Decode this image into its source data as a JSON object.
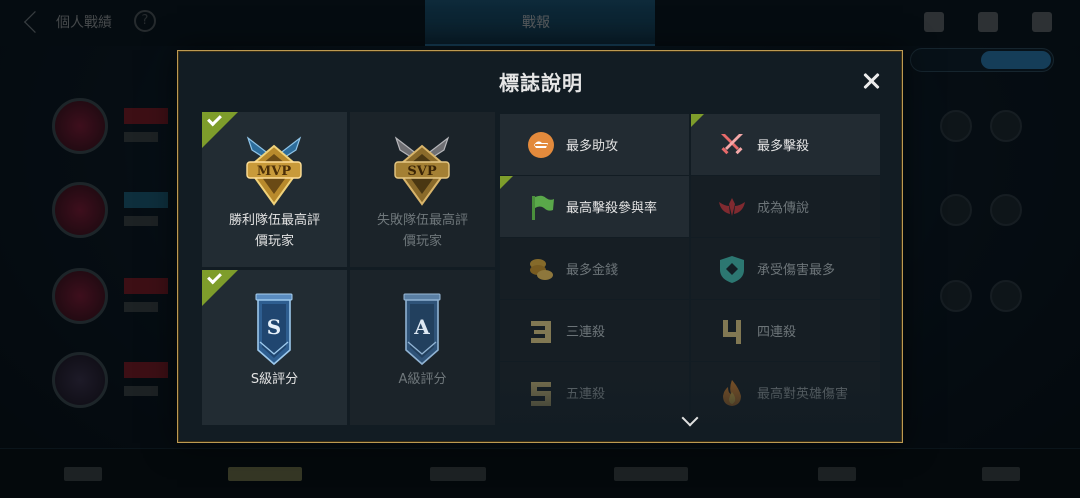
{
  "background": {
    "top_title": "個人戰績",
    "center_tab": "戰報",
    "help_symbol": "?"
  },
  "modal": {
    "title": "標誌說明",
    "close_label": "✕"
  },
  "rank_badges": [
    {
      "badge_text": "MVP",
      "label_line1": "勝利隊伍最高評",
      "label_line2": "價玩家",
      "achieved": true
    },
    {
      "badge_text": "SVP",
      "label_line1": "失敗隊伍最高評",
      "label_line2": "價玩家",
      "achieved": false
    },
    {
      "badge_text": "S",
      "label_line1": "S級評分",
      "label_line2": "",
      "achieved": true
    },
    {
      "badge_text": "A",
      "label_line1": "A級評分",
      "label_line2": "",
      "achieved": false
    }
  ],
  "features": [
    {
      "label": "最多助攻",
      "icon": "handshake-icon",
      "achieved": false,
      "color": "#e38a3c"
    },
    {
      "label": "最多擊殺",
      "icon": "crossed-swords-icon",
      "achieved": true,
      "color": "#e86a6a"
    },
    {
      "label": "最高擊殺參與率",
      "icon": "flag-icon",
      "achieved": true,
      "color": "#5aa84a"
    },
    {
      "label": "成為傳說",
      "icon": "legend-wings-icon",
      "achieved": false,
      "color": "#d8343a"
    },
    {
      "label": "最多金錢",
      "icon": "coins-icon",
      "achieved": false,
      "color": "#e0a830"
    },
    {
      "label": "承受傷害最多",
      "icon": "shield-icon",
      "achieved": false,
      "color": "#3fc0b0"
    },
    {
      "label": "三連殺",
      "icon": "triple-kill-icon",
      "achieved": false,
      "color": "#d9c27a"
    },
    {
      "label": "四連殺",
      "icon": "quadra-kill-icon",
      "achieved": false,
      "color": "#d9c27a"
    },
    {
      "label": "五連殺",
      "icon": "penta-kill-icon",
      "achieved": false,
      "color": "#d9c27a"
    },
    {
      "label": "最高對英雄傷害",
      "icon": "fire-icon",
      "achieved": false,
      "color": "#e0862a"
    }
  ]
}
